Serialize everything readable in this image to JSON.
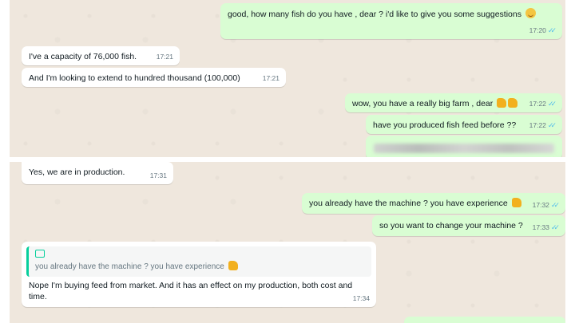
{
  "colors": {
    "incoming": "#ffffff",
    "outgoing": "#d9fdd3",
    "read_ticks": "#53bdeb",
    "quote_bar": "#06cf9c"
  },
  "chat1": [
    {
      "text": "good, how many fish do you have , dear ? i'd like to give you some suggestions",
      "time": "17:20",
      "emoji": "smiling-face-icon"
    },
    {
      "text": "I've a capacity of 76,000 fish.",
      "time": "17:21"
    },
    {
      "text": "And I'm looking to extend to hundred thousand (100,000)",
      "time": "17:21"
    },
    {
      "text": "wow, you have a really big farm , dear",
      "time": "17:22",
      "emoji": "thumbs-up-icon"
    },
    {
      "text": "have you produced fish feed before ??",
      "time": "17:22"
    }
  ],
  "chat2": [
    {
      "text": "Yes, we are in production.",
      "time": "17:31"
    },
    {
      "text": "you already have the machine ? you have experience",
      "time": "17:32",
      "emoji": "thumbs-up-icon"
    },
    {
      "text": "so you want to change your machine ?",
      "time": "17:33"
    },
    {
      "quote": "you already have the machine ? you have experience",
      "text": "Nope I'm buying feed from market. And it has an effect on my production, both cost and time.",
      "time": "17:34"
    }
  ]
}
